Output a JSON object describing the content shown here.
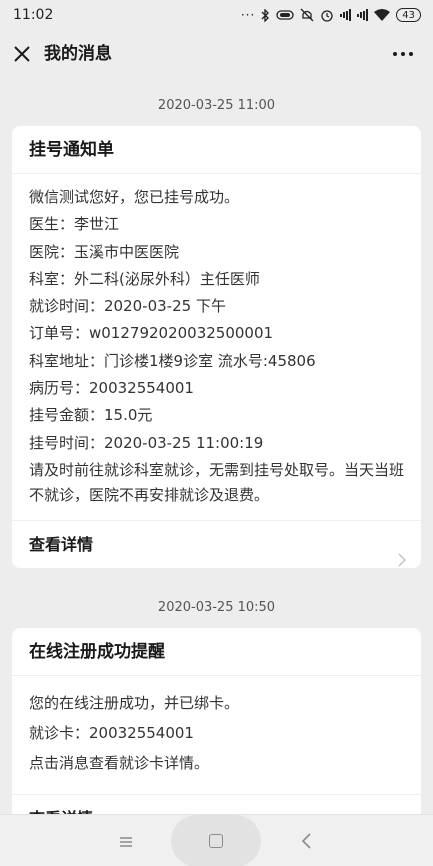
{
  "status_bar": {
    "time": "11:02",
    "battery": "43"
  },
  "header": {
    "title": "我的消息"
  },
  "messages": [
    {
      "timestamp": "2020-03-25 11:00",
      "title": "挂号通知单",
      "greeting": "微信测试您好，您已挂号成功。",
      "lines": [
        "医生：李世江",
        "医院：玉溪市中医医院",
        "科室：外二科(泌尿外科）主任医师",
        "就诊时间：2020-03-25 下午",
        "订单号：w012792020032500001",
        "科室地址：门诊楼1楼9诊室 流水号:45806",
        "病历号：20032554001",
        "挂号金额：15.0元",
        "挂号时间：2020-03-25 11:00:19"
      ],
      "note": "请及时前往就诊科室就诊，无需到挂号处取号。当天当班不就诊，医院不再安排就诊及退费。",
      "details_label": "查看详情"
    },
    {
      "timestamp": "2020-03-25 10:50",
      "title": "在线注册成功提醒",
      "lines": [
        "您的在线注册成功，并已绑卡。",
        "就诊卡：20032554001",
        "点击消息查看就诊卡详情。"
      ],
      "details_label": "查看详情"
    }
  ]
}
